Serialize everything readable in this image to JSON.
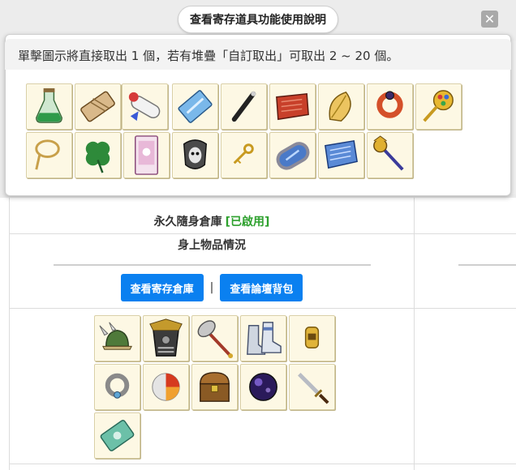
{
  "popup": {
    "title": "查看寄存道具功能使用說明",
    "close_glyph": "✕",
    "message": "單擊圖示將直接取出 1 個，若有堆疊「自訂取出」可取出 2 ~ 20 個。",
    "storage_items": [
      {
        "icon": "green-potion-icon"
      },
      {
        "icon": "bandage-card-icon"
      },
      {
        "icon": "rolled-scroll-icon"
      },
      {
        "icon": "blue-crystal-card-icon"
      },
      {
        "icon": "black-wand-icon"
      },
      {
        "icon": "red-scroll-icon"
      },
      {
        "icon": "golden-leaf-icon"
      },
      {
        "icon": "red-ring-icon"
      },
      {
        "icon": "golden-gem-key-icon"
      },
      {
        "icon": "rope-amulet-icon"
      },
      {
        "icon": "four-leaf-clover-icon"
      },
      {
        "icon": "pink-card-icon"
      },
      {
        "icon": "skull-mask-icon"
      },
      {
        "icon": "small-key-icon"
      },
      {
        "icon": "mirror-frame-icon"
      },
      {
        "icon": "blue-scroll-icon"
      },
      {
        "icon": "golden-mace-icon"
      }
    ]
  },
  "page": {
    "storage_status_label": "永久隨身倉庫",
    "storage_status_value": "[已啟用]",
    "inventory_title": "身上物品情況",
    "view_storage_button": "查看寄存倉庫",
    "separator": "|",
    "view_forum_bag_button": "查看論壇背包",
    "inventory_items": [
      {
        "icon": "winged-helmet-icon"
      },
      {
        "icon": "dark-armor-icon"
      },
      {
        "icon": "axe-staff-icon"
      },
      {
        "icon": "silver-boots-icon"
      },
      {
        "icon": "gold-bracelet-icon"
      },
      {
        "icon": "silver-ring-icon"
      },
      {
        "icon": "red-orb-icon"
      },
      {
        "icon": "treasure-chest-icon"
      },
      {
        "icon": "dark-orb-icon"
      },
      {
        "icon": "short-dagger-icon"
      },
      {
        "icon": "green-jade-card-icon"
      }
    ]
  },
  "colors": {
    "primary_button": "#0a80f0",
    "enabled_status": "#2ea12e",
    "slot_background": "#fdf8e4"
  }
}
